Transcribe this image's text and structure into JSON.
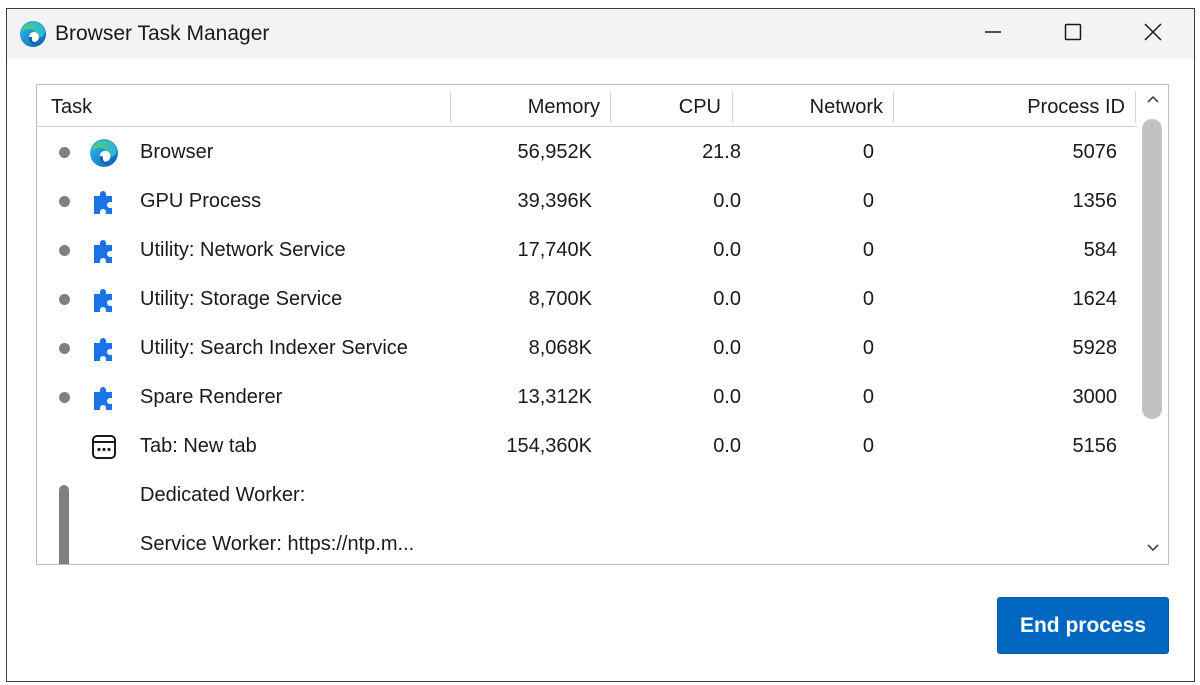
{
  "window": {
    "title": "Browser Task Manager",
    "icon": "edge-logo-icon"
  },
  "controls": {
    "minimize_icon": "minimize-icon",
    "maximize_icon": "maximize-icon",
    "close_icon": "close-icon"
  },
  "table": {
    "headers": {
      "task": "Task",
      "memory": "Memory",
      "cpu": "CPU",
      "network": "Network",
      "pid": "Process ID"
    },
    "rows": [
      {
        "task": "Browser",
        "memory": "56,952K",
        "cpu": "21.8",
        "network": "0",
        "pid": "5076",
        "icon": "edge-logo-icon"
      },
      {
        "task": "GPU Process",
        "memory": "39,396K",
        "cpu": "0.0",
        "network": "0",
        "pid": "1356",
        "icon": "puzzle-piece-icon"
      },
      {
        "task": "Utility: Network Service",
        "memory": "17,740K",
        "cpu": "0.0",
        "network": "0",
        "pid": "584",
        "icon": "puzzle-piece-icon"
      },
      {
        "task": "Utility: Storage Service",
        "memory": "8,700K",
        "cpu": "0.0",
        "network": "0",
        "pid": "1624",
        "icon": "puzzle-piece-icon"
      },
      {
        "task": "Utility: Search Indexer Service",
        "memory": "8,068K",
        "cpu": "0.0",
        "network": "0",
        "pid": "5928",
        "icon": "puzzle-piece-icon"
      },
      {
        "task": "Spare Renderer",
        "memory": "13,312K",
        "cpu": "0.0",
        "network": "0",
        "pid": "3000",
        "icon": "puzzle-piece-icon"
      },
      {
        "task": "Tab: New tab",
        "memory": "154,360K",
        "cpu": "0.0",
        "network": "0",
        "pid": "5156",
        "icon": "tab-icon"
      },
      {
        "task": "Dedicated Worker:",
        "memory": "",
        "cpu": "",
        "network": "",
        "pid": ""
      },
      {
        "task": "Service Worker: https://ntp.m...",
        "memory": "",
        "cpu": "",
        "network": "",
        "pid": ""
      }
    ]
  },
  "scrollbar": {
    "up_icon": "chevron-up-icon",
    "down_icon": "chevron-down-icon"
  },
  "actions": {
    "end_process_label": "End process"
  },
  "colors": {
    "accent": "#0067c0",
    "puzzle_icon": "#1a73e8",
    "titlebar": "#f3f3f3"
  }
}
